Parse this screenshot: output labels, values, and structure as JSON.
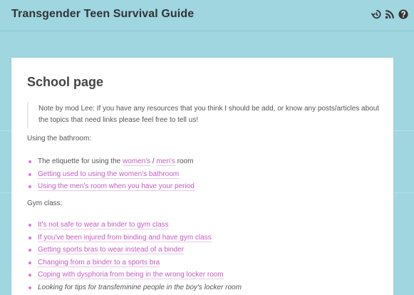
{
  "header": {
    "site_title": "Transgender Teen Survival Guide",
    "icons": [
      "history-icon",
      "rss-icon",
      "help-icon"
    ]
  },
  "colors": {
    "background": "#9fd6e0",
    "link": "#c45bc4",
    "bullet": "#d97ad3"
  },
  "page": {
    "title": "School page",
    "note": "Note by mod Lee: If you have any resources that you think I should be add, or know any posts/articles about the topics that need links please feel free to tell us!",
    "bathroom": {
      "label": "Using the bathroom:",
      "item1_prefix": "The etiquette for using the ",
      "item1_link_a": "women's",
      "item1_sep": " / ",
      "item1_link_b": "men's",
      "item1_suffix": " room",
      "items": [
        "Getting used to using the women's bathroom",
        "Using the men's room when you have your period"
      ]
    },
    "gym": {
      "label": "Gym class:",
      "items": [
        "It's not safe to wear a binder to gym class",
        "If you've been injured from binding and have gym class",
        "Getting sports bras to wear instead of a binder",
        "Changing from a binder to a sports bra",
        "Coping with dysphoria from being in the wrong locker room"
      ],
      "italic_item": "Looking for tips for transfeminine people in the boy's locker room"
    }
  }
}
